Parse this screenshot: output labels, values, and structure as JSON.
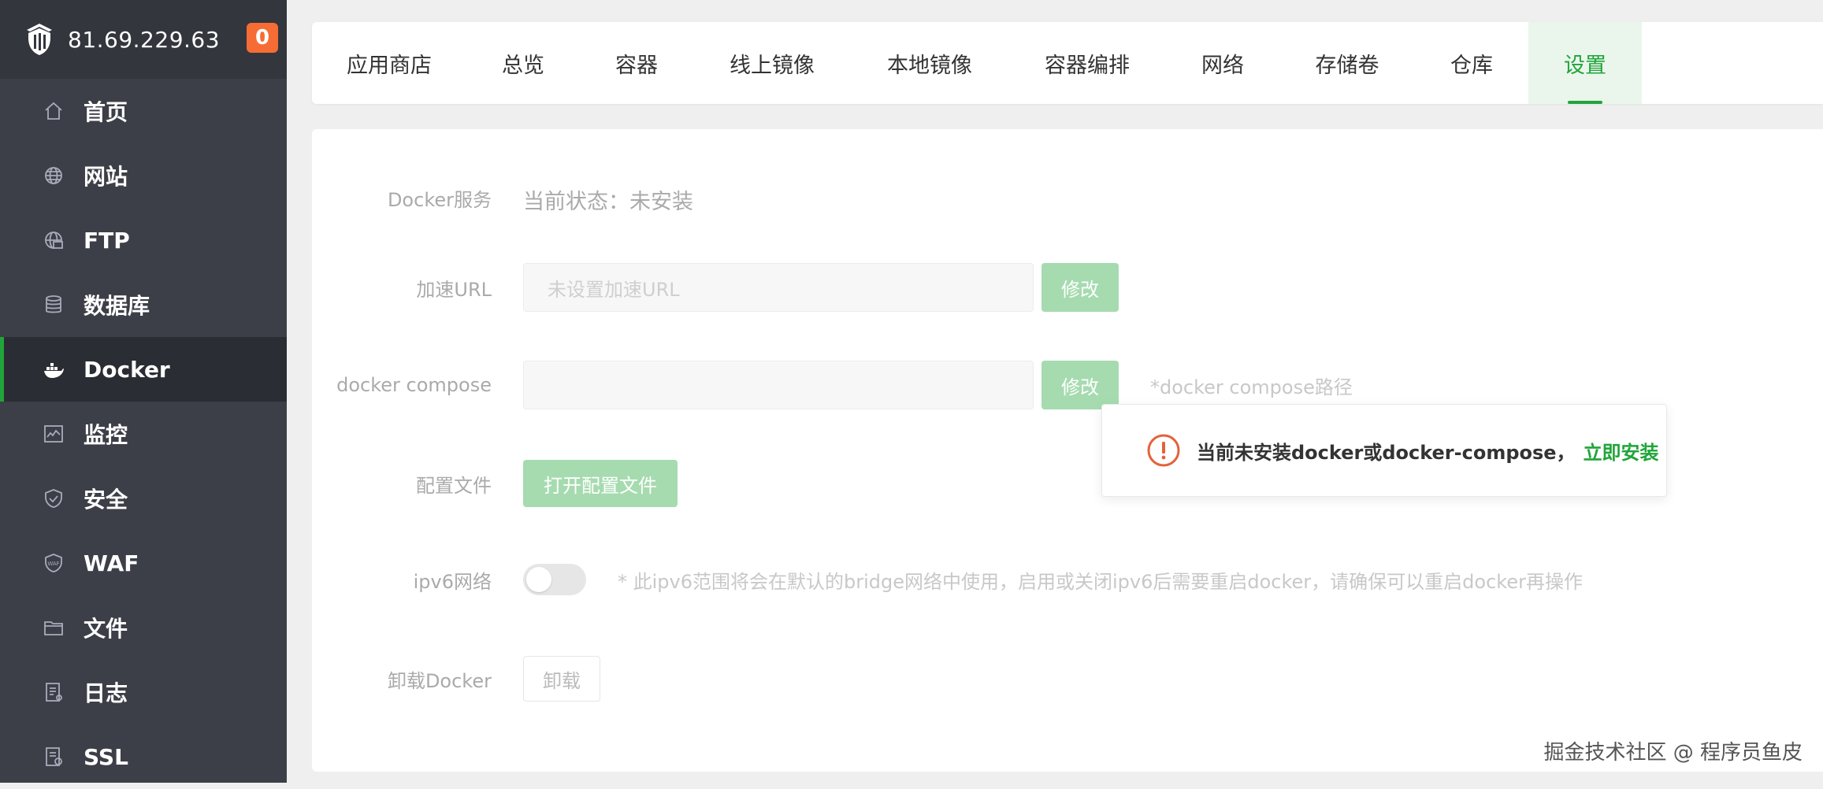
{
  "sidebar": {
    "server_ip": "81.69.229.63",
    "badge_count": "0",
    "items": [
      {
        "label": "首页",
        "icon": "home-icon"
      },
      {
        "label": "网站",
        "icon": "globe-icon"
      },
      {
        "label": "FTP",
        "icon": "ftp-icon"
      },
      {
        "label": "数据库",
        "icon": "database-icon"
      },
      {
        "label": "Docker",
        "icon": "docker-icon",
        "active": true
      },
      {
        "label": "监控",
        "icon": "monitor-icon"
      },
      {
        "label": "安全",
        "icon": "shield-icon"
      },
      {
        "label": "WAF",
        "icon": "waf-icon"
      },
      {
        "label": "文件",
        "icon": "folder-icon"
      },
      {
        "label": "日志",
        "icon": "log-icon"
      },
      {
        "label": "SSL",
        "icon": "ssl-icon"
      }
    ]
  },
  "tabs": [
    {
      "label": "应用商店"
    },
    {
      "label": "总览"
    },
    {
      "label": "容器"
    },
    {
      "label": "线上镜像"
    },
    {
      "label": "本地镜像"
    },
    {
      "label": "容器编排"
    },
    {
      "label": "网络"
    },
    {
      "label": "存储卷"
    },
    {
      "label": "仓库"
    },
    {
      "label": "设置",
      "active": true
    }
  ],
  "settings": {
    "docker_service_label": "Docker服务",
    "docker_service_status": "当前状态：未安装",
    "accel_url_label": "加速URL",
    "accel_url_placeholder": "未设置加速URL",
    "modify_label": "修改",
    "compose_label": "docker compose",
    "compose_value": "",
    "compose_hint": "*docker compose路径",
    "config_file_label": "配置文件",
    "open_config_button": "打开配置文件",
    "ipv6_label": "ipv6网络",
    "ipv6_enabled": false,
    "ipv6_hint": "* 此ipv6范围将会在默认的bridge网络中使用，启用或关闭ipv6后需要重启docker，请确保可以重启docker再操作",
    "uninstall_label": "卸载Docker",
    "uninstall_button": "卸载"
  },
  "popup": {
    "message": "当前未安装docker或docker-compose，",
    "link": "立即安装",
    "icon": "warning-icon"
  },
  "watermark": "掘金技术社区 @ 程序员鱼皮",
  "colors": {
    "accent": "#20a53a",
    "sidebar_bg": "#3c3f47",
    "badge": "#f56c34",
    "warning": "#e5613a"
  }
}
